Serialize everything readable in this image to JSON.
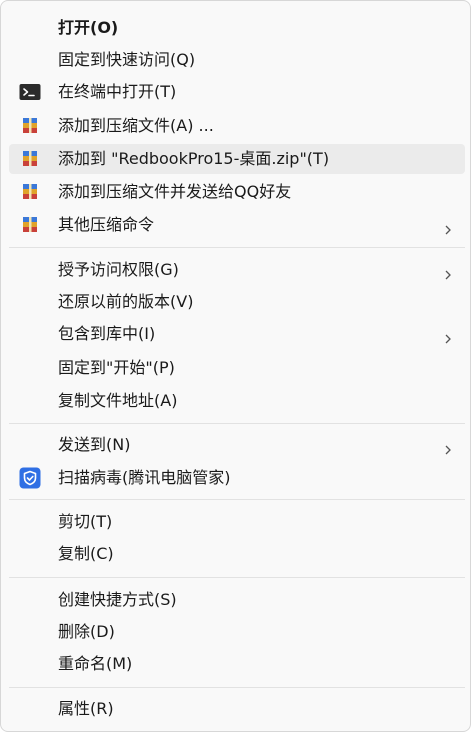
{
  "menu": {
    "items": [
      {
        "label": "打开(O)"
      },
      {
        "label": "固定到快速访问(Q)"
      },
      {
        "label": "在终端中打开(T)",
        "icon": "terminal-icon"
      },
      {
        "label": "添加到压缩文件(A) ...",
        "icon": "winrar-icon"
      },
      {
        "label": "添加到 \"RedbookPro15-桌面.zip\"(T)",
        "icon": "winrar-icon"
      },
      {
        "label": "添加到压缩文件并发送给QQ好友",
        "icon": "winrar-icon"
      },
      {
        "label": "其他压缩命令",
        "icon": "winrar-icon"
      },
      {
        "label": "授予访问权限(G)"
      },
      {
        "label": "还原以前的版本(V)"
      },
      {
        "label": "包含到库中(I)"
      },
      {
        "label": "固定到\"开始\"(P)"
      },
      {
        "label": "复制文件地址(A)"
      },
      {
        "label": "发送到(N)"
      },
      {
        "label": "扫描病毒(腾讯电脑管家)",
        "icon": "tencent-pc-manager-shield-icon"
      },
      {
        "label": "剪切(T)"
      },
      {
        "label": "复制(C)"
      },
      {
        "label": "创建快捷方式(S)"
      },
      {
        "label": "删除(D)"
      },
      {
        "label": "重命名(M)"
      },
      {
        "label": "属性(R)"
      }
    ],
    "colors": {
      "background": "#f9f9f9",
      "hover": "#ebebeb",
      "text": "#1a1a1a",
      "separator": "#e2e2e2",
      "shield_blue": "#2f6fe4"
    }
  }
}
